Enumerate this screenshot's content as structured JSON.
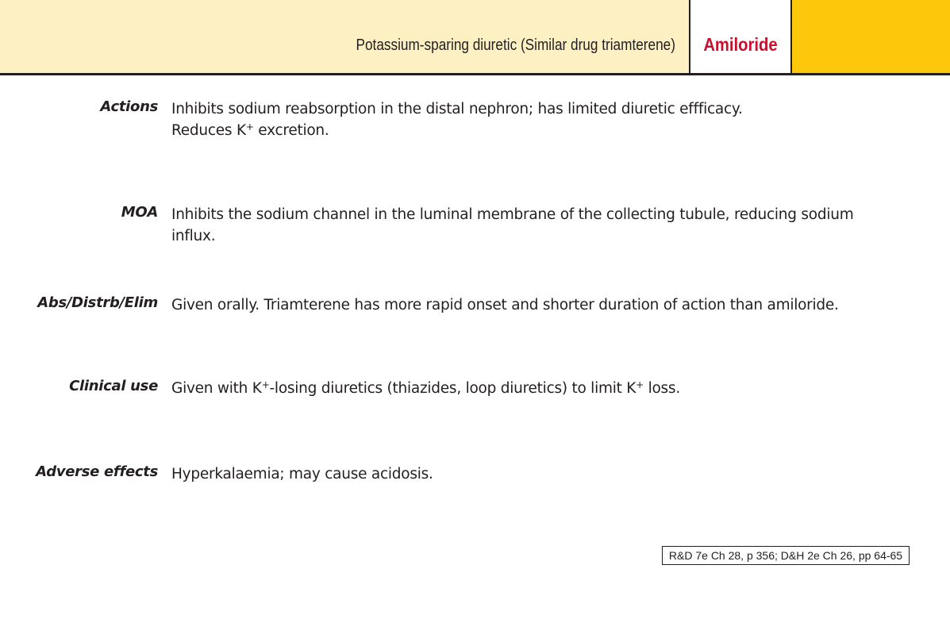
{
  "header": {
    "subtitle": "Potassium-sparing diuretic (Similar drug triamterene)",
    "title": "Amiloride",
    "accent_color": "#fdc70c",
    "band_color": "#fdf0c2",
    "title_color": "#c8102e"
  },
  "sections": {
    "actions": {
      "label": "Actions",
      "line1": "Inhibits sodium reabsorption  in the distal nephron; has limited diuretic effficacy.",
      "line2_pre": "Reduces K",
      "line2_sup": "+",
      "line2_post": " excretion."
    },
    "moa": {
      "label": "MOA",
      "text": "Inhibits the sodium channel in the luminal membrane of the collecting tubule, reducing sodium influx."
    },
    "abs": {
      "label": "Abs/Distrb/Elim",
      "text": "Given orally.  Triamterene has more rapid onset and  shorter duration of action  than amiloride."
    },
    "clinical": {
      "label": "Clinical use",
      "pre": "Given with K",
      "sup1": "+",
      "mid": "-losing diuretics (thiazides, loop diuretics) to limit K",
      "sup2": "+",
      "post": " loss."
    },
    "adverse": {
      "label": "Adverse effects",
      "text": "Hyperkalaemia; may cause acidosis."
    }
  },
  "reference": "R&D 7e Ch 28, p 356; D&H 2e Ch 26, pp 64-65"
}
